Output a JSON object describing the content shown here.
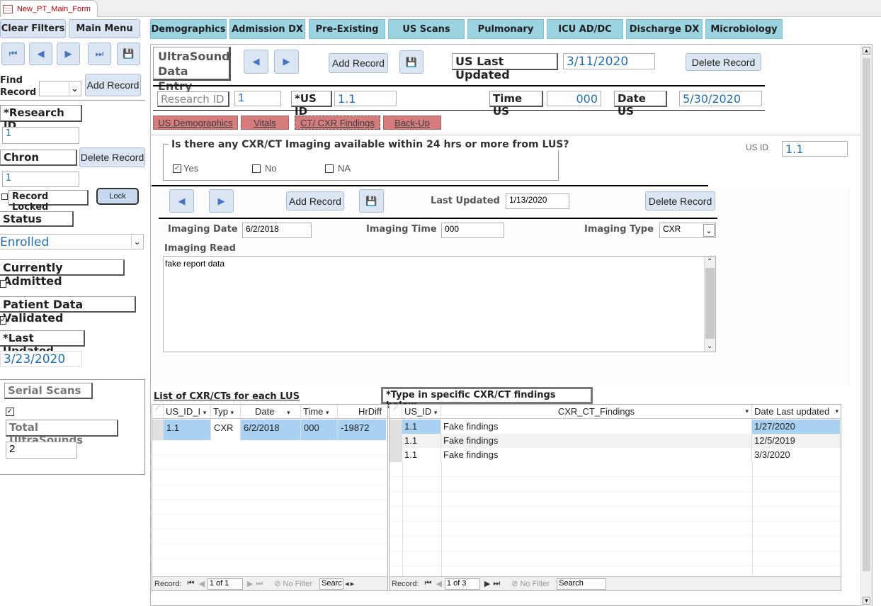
{
  "window": {
    "tab_title": "New_PT_Main_Form"
  },
  "left": {
    "clear_filters": "Clear Filters",
    "main_menu": "Main Menu",
    "find_record": "Find Record",
    "add_record": "Add Record",
    "research_id_label": "*Research ID",
    "research_id_value": "1",
    "chron_label": "Chron",
    "delete_record": "Delete Record",
    "chron_value": "1",
    "record_locked_label": "Record Locked",
    "lock_button": "Lock",
    "status_label": "Status",
    "status_value": "Enrolled",
    "currently_admitted_label": "Currently Admitted",
    "patient_data_validated_label": "Patient Data Validated",
    "last_updated_label": "*Last Updated",
    "last_updated_value": "3/23/2020",
    "serial_scans_label": "Serial Scans",
    "total_ultrasounds_label": "Total UltraSounds",
    "total_ultrasounds_value": "2"
  },
  "topnav": [
    "Demographics",
    "Admission DX",
    "Pre-Existing",
    "US Scans",
    "Pulmonary",
    "ICU AD/DC",
    "Discharge DX",
    "Microbiology"
  ],
  "us_form": {
    "title": "UltraSound Data Entry",
    "add_record": "Add Record",
    "last_updated_label": "US Last Updated",
    "last_updated_value": "3/11/2020",
    "delete_record": "Delete Record",
    "research_id_label": "Research ID",
    "research_id_value": "1",
    "us_id_label": "*US ID",
    "us_id_value": "1.1",
    "time_label": "Time US",
    "time_value": "000",
    "date_label": "Date US",
    "date_value": "5/30/2020"
  },
  "subtabs": [
    "US Demographics",
    "Vitals",
    "CT/ CXR Findings",
    "Back-Up"
  ],
  "imaging_question": {
    "text": "Is there any CXR/CT Imaging available within 24 hrs or more from LUS?",
    "options": [
      "Yes",
      "No",
      "NA"
    ],
    "selected": "Yes"
  },
  "side_usid": {
    "label": "US ID",
    "value": "1.1"
  },
  "subform": {
    "add_record": "Add Record",
    "last_updated_label": "Last Updated",
    "last_updated_value": "1/13/2020",
    "delete_record": "Delete Record",
    "imaging_date_label": "Imaging Date",
    "imaging_date_value": "6/2/2018",
    "imaging_time_label": "Imaging Time",
    "imaging_time_value": "000",
    "imaging_type_label": "Imaging Type",
    "imaging_type_value": "CXR",
    "imaging_read_label": "Imaging Read",
    "imaging_read_value": "fake report data"
  },
  "list_left": {
    "title": "List of CXR/CTs for each LUS",
    "columns": [
      "US_ID_I",
      "Typ",
      "Date",
      "Time",
      "HrDiff"
    ],
    "rows": [
      [
        "1.1",
        "CXR",
        "6/2/2018",
        "000",
        "-19872"
      ]
    ],
    "nav": {
      "label": "Record:",
      "position": "1 of 1",
      "filter": "No Filter",
      "search": "Searc"
    }
  },
  "list_right": {
    "title": "*Type in specific CXR/CT findings below",
    "columns": [
      "US_ID",
      "CXR_CT_Findings",
      "Date Last updated"
    ],
    "rows": [
      [
        "1.1",
        "Fake findings",
        "1/27/2020"
      ],
      [
        "1.1",
        "Fake findings",
        "12/5/2019"
      ],
      [
        "1.1",
        "Fake findings",
        "3/3/2020"
      ]
    ],
    "nav": {
      "label": "Record:",
      "position": "1 of 3",
      "filter": "No Filter",
      "search": "Search"
    }
  },
  "colors": {
    "topnav": "#9bd3e0",
    "subtab": "#d77c7c",
    "selected_row": "#a9d2f2",
    "field_blue": "#1f6fb5"
  }
}
